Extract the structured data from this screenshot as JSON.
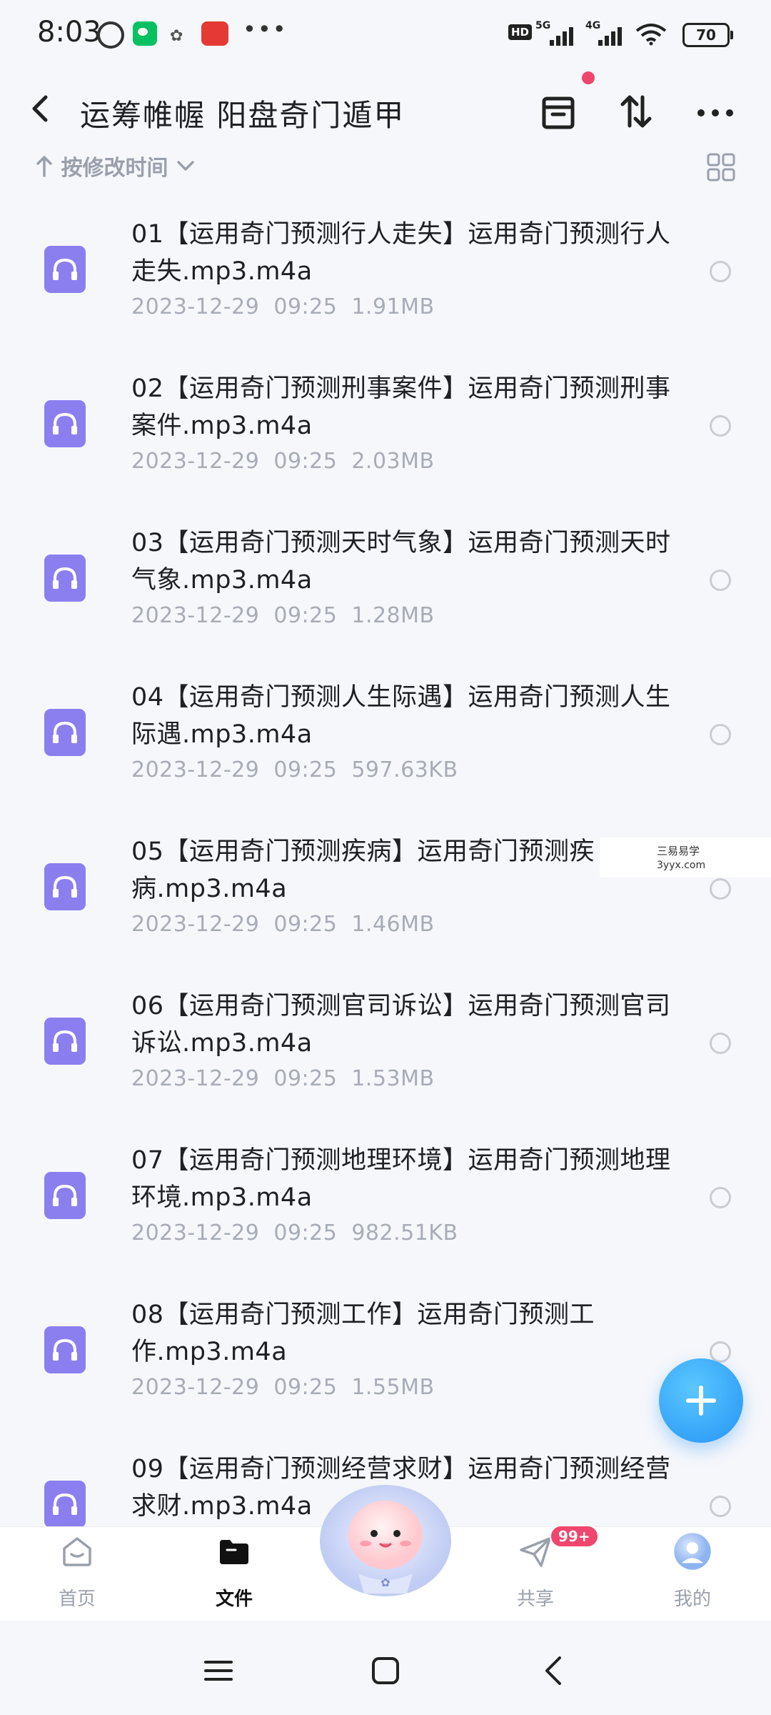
{
  "status_bar": {
    "time": "8:03",
    "hd": "HD",
    "net1": "5G",
    "net2": "4G",
    "battery": "70"
  },
  "header": {
    "title": "运筹帷幄 阳盘奇门遁甲"
  },
  "sort": {
    "label": "按修改时间"
  },
  "files": [
    {
      "name": "01【运用奇门预测行人走失】运用奇门预测行人走失.mp3.m4a",
      "date": "2023-12-29",
      "time": "09:25",
      "size": "1.91MB"
    },
    {
      "name": "02【运用奇门预测刑事案件】运用奇门预测刑事案件.mp3.m4a",
      "date": "2023-12-29",
      "time": "09:25",
      "size": "2.03MB"
    },
    {
      "name": "03【运用奇门预测天时气象】运用奇门预测天时气象.mp3.m4a",
      "date": "2023-12-29",
      "time": "09:25",
      "size": "1.28MB"
    },
    {
      "name": "04【运用奇门预测人生际遇】运用奇门预测人生际遇.mp3.m4a",
      "date": "2023-12-29",
      "time": "09:25",
      "size": "597.63KB"
    },
    {
      "name": "05【运用奇门预测疾病】运用奇门预测疾病.mp3.m4a",
      "date": "2023-12-29",
      "time": "09:25",
      "size": "1.46MB"
    },
    {
      "name": "06【运用奇门预测官司诉讼】运用奇门预测官司诉讼.mp3.m4a",
      "date": "2023-12-29",
      "time": "09:25",
      "size": "1.53MB"
    },
    {
      "name": "07【运用奇门预测地理环境】运用奇门预测地理环境.mp3.m4a",
      "date": "2023-12-29",
      "time": "09:25",
      "size": "982.51KB"
    },
    {
      "name": "08【运用奇门预测工作】运用奇门预测工作.mp3.m4a",
      "date": "2023-12-29",
      "time": "09:25",
      "size": "1.55MB"
    },
    {
      "name": "09【运用奇门预测经营求财】运用奇门预测经营求财.mp3.m4a",
      "date": "",
      "time": "",
      "size": ""
    }
  ],
  "watermark": {
    "title": "三易易学",
    "url": "3yyx.com"
  },
  "bottom_nav": {
    "home": "首页",
    "files": "文件",
    "share": "共享",
    "me": "我的",
    "share_badge": "99+"
  },
  "colors": {
    "accent": "#2694f5",
    "file_icon": "#8b7ff0",
    "badge": "#f0456d"
  }
}
